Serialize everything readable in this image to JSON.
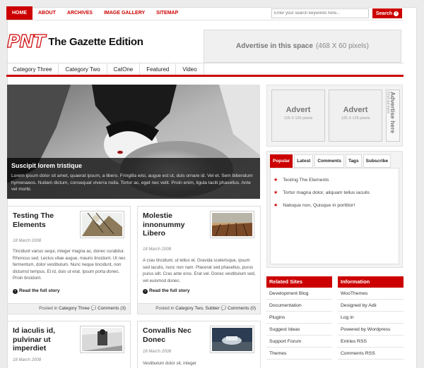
{
  "topnav": {
    "items": [
      "HOME",
      "ABOUT",
      "ARCHIVES",
      "IMAGE GALLERY",
      "SITEMAP"
    ]
  },
  "search": {
    "placeholder": "Enter your search keywords here...",
    "button": "Search"
  },
  "logo": {
    "mark": "PNT",
    "name": "The Gazette Edition"
  },
  "ad_banner": {
    "bold": "Advertise in this space",
    "dim": "(468 X 60 pixels)"
  },
  "catnav": [
    "Category Three",
    "Category Two",
    "CatOne",
    "Featured",
    "Video"
  ],
  "feature": {
    "title": "Suscipit lorem tristique",
    "text": "Lorem ipsum dolor sit amet, quaerat ipsum, a libero. Fringilla wisi, augue est ut, duis ornare id. Vel et. Sem bibendum hymenaeos. Nullam dictum, consequat viverra nulla. Tortor ac, eget nec velit. Proin enim, ligula taciti phasellus. Ante vel morbi."
  },
  "posts": [
    {
      "title": "Testing The Elements",
      "date": "18 March 2008",
      "excerpt": "Tincidunt varius sequi, integer magna ac, donec curabitur. Rhoncus sed. Lectus vitae augue, mauris tincidunt. Ut nec fermentum, dolor vestibulum. Nunc neque tincidunt, non dictumst tempus. Et id, duis ut erat. Ipsum porta donec. Proin tincidunt.",
      "more": "Read the full story",
      "posted_in": "Posted in",
      "cat": "Category Three",
      "comments": "Comments (3)"
    },
    {
      "title": "Molestie innonummy Libero",
      "date": "18 March 2008",
      "excerpt": "A cras tincidunt, ut tellus et. Gravida scelerisque, ipsum sed iaculis, nunc non nam. Placerat sed phasellus, purus purus elit. Cras ante eros. Erat vel. Donec vestibulum sed, vel euismod donec.",
      "more": "Read the full story",
      "posted_in": "Posted in",
      "cat": "Category Two, Subber",
      "comments": "Comments (0)"
    },
    {
      "title": "Id iaculis id, pulvinar ut imperdiet",
      "date": "18 March 2008"
    },
    {
      "title": "Convallis Nec Donec",
      "date": "18 March 2008",
      "excerpt": "Vestibulum dolor sit, integer"
    }
  ],
  "side_ads": {
    "advert": "Advert",
    "size": "125 X 125 pixels",
    "vertical": "Advertise here",
    "vsub": "Find out more"
  },
  "tabs": {
    "labels": [
      "Popular",
      "Latest",
      "Comments",
      "Tags",
      "Subscribe"
    ],
    "popular": [
      "Testing The Elements",
      "Tortor magna dolor, aliquam tellus iaculis",
      "Natoque non, Quisque in porttitor!"
    ]
  },
  "related": {
    "title": "Related Sites",
    "items": [
      "Development Blog",
      "Documentation",
      "Plugins",
      "Suggest Ideas",
      "Support Forum",
      "Themes"
    ]
  },
  "information": {
    "title": "Information",
    "items": [
      "WooThemes",
      "Designed by Adii",
      "Log in",
      "Powered by Wordpress",
      "Entries RSS",
      "Comments RSS"
    ]
  },
  "colors": {
    "accent": "#cc0000",
    "background": "#ececec"
  }
}
